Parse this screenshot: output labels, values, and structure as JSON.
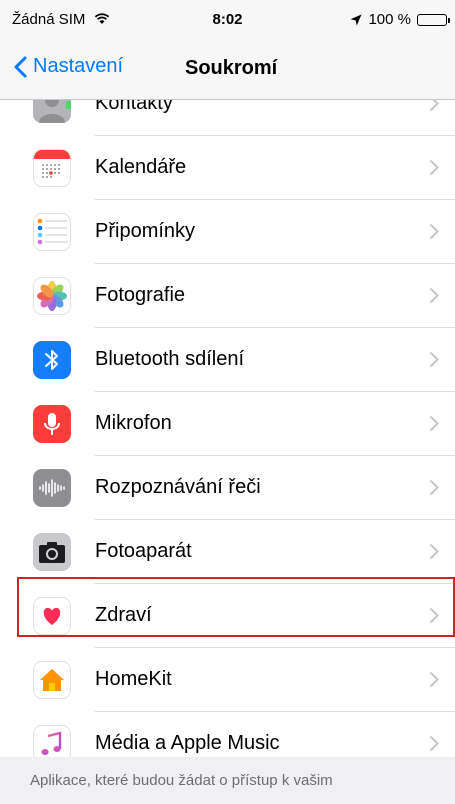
{
  "status": {
    "carrier": "Žádná SIM",
    "time": "8:02",
    "battery": "100 %"
  },
  "nav": {
    "back_label": "Nastavení",
    "title": "Soukromí"
  },
  "rows": [
    {
      "label": "Kontakty",
      "icon": "contacts-icon"
    },
    {
      "label": "Kalendáře",
      "icon": "calendar-icon"
    },
    {
      "label": "Připomínky",
      "icon": "reminders-icon"
    },
    {
      "label": "Fotografie",
      "icon": "photos-icon"
    },
    {
      "label": "Bluetooth sdílení",
      "icon": "bluetooth-icon"
    },
    {
      "label": "Mikrofon",
      "icon": "microphone-icon"
    },
    {
      "label": "Rozpoznávání řeči",
      "icon": "speech-recognition-icon"
    },
    {
      "label": "Fotoaparát",
      "icon": "camera-icon"
    },
    {
      "label": "Zdraví",
      "icon": "health-icon"
    },
    {
      "label": "HomeKit",
      "icon": "homekit-icon"
    },
    {
      "label": "Média a Apple Music",
      "icon": "music-icon"
    }
  ],
  "footer": {
    "text": "Aplikace, které budou žádat o přístup k vašim"
  },
  "colors": {
    "accent": "#007aff",
    "highlight": "#d0232a"
  }
}
